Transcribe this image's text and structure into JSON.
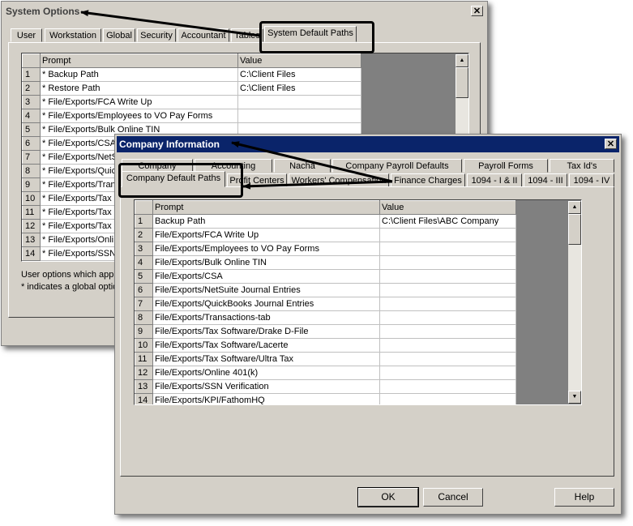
{
  "system_options": {
    "title": "System Options",
    "close_glyph": "✕",
    "tabs": [
      "User",
      "Workstation",
      "Global",
      "Security",
      "Accountant",
      "Tables",
      "System Default Paths"
    ],
    "headers": {
      "prompt": "Prompt",
      "value": "Value"
    },
    "rows": [
      {
        "n": "1",
        "prompt": "* Backup Path",
        "value": "C:\\Client Files"
      },
      {
        "n": "2",
        "prompt": "* Restore Path",
        "value": "C:\\Client Files"
      },
      {
        "n": "3",
        "prompt": "* File/Exports/FCA Write Up",
        "value": ""
      },
      {
        "n": "4",
        "prompt": "* File/Exports/Employees to VO Pay Forms",
        "value": ""
      },
      {
        "n": "5",
        "prompt": "* File/Exports/Bulk Online TIN",
        "value": ""
      },
      {
        "n": "6",
        "prompt": "* File/Exports/CSA",
        "value": ""
      },
      {
        "n": "7",
        "prompt": "* File/Exports/NetS",
        "value": ""
      },
      {
        "n": "8",
        "prompt": "* File/Exports/Quic",
        "value": ""
      },
      {
        "n": "9",
        "prompt": "* File/Exports/Tran",
        "value": ""
      },
      {
        "n": "10",
        "prompt": "* File/Exports/Tax",
        "value": ""
      },
      {
        "n": "11",
        "prompt": "* File/Exports/Tax",
        "value": ""
      },
      {
        "n": "12",
        "prompt": "* File/Exports/Tax",
        "value": ""
      },
      {
        "n": "13",
        "prompt": "* File/Exports/Onli",
        "value": ""
      },
      {
        "n": "14",
        "prompt": "* File/Exports/SSN",
        "value": ""
      }
    ],
    "note_line1": "User options which appl",
    "note_line2": "* indicates a global optio"
  },
  "company_info": {
    "title": "Company Information",
    "close_glyph": "✕",
    "tabs_back": [
      "Company",
      "Accounting",
      "Nacha",
      "Company Payroll Defaults",
      "Payroll Forms",
      "Tax Id's"
    ],
    "tabs_front": [
      "Company Default Paths",
      "Profit Centers",
      "Workers' Compensation",
      "Finance Charges",
      "1094 - I & II",
      "1094 - III",
      "1094 - IV"
    ],
    "headers": {
      "prompt": "Prompt",
      "value": "Value"
    },
    "rows": [
      {
        "n": "1",
        "prompt": "Backup Path",
        "value": "C:\\Client Files\\ABC Company"
      },
      {
        "n": "2",
        "prompt": "File/Exports/FCA Write Up",
        "value": ""
      },
      {
        "n": "3",
        "prompt": "File/Exports/Employees to VO Pay Forms",
        "value": ""
      },
      {
        "n": "4",
        "prompt": "File/Exports/Bulk Online TIN",
        "value": ""
      },
      {
        "n": "5",
        "prompt": "File/Exports/CSA",
        "value": ""
      },
      {
        "n": "6",
        "prompt": "File/Exports/NetSuite Journal Entries",
        "value": ""
      },
      {
        "n": "7",
        "prompt": "File/Exports/QuickBooks Journal Entries",
        "value": ""
      },
      {
        "n": "8",
        "prompt": "File/Exports/Transactions-tab",
        "value": ""
      },
      {
        "n": "9",
        "prompt": "File/Exports/Tax Software/Drake D-File",
        "value": ""
      },
      {
        "n": "10",
        "prompt": "File/Exports/Tax Software/Lacerte",
        "value": ""
      },
      {
        "n": "11",
        "prompt": "File/Exports/Tax Software/Ultra Tax",
        "value": ""
      },
      {
        "n": "12",
        "prompt": "File/Exports/Online 401(k)",
        "value": ""
      },
      {
        "n": "13",
        "prompt": "File/Exports/SSN Verification",
        "value": ""
      },
      {
        "n": "14",
        "prompt": "File/Exports/KPI/FathomHQ",
        "value": ""
      }
    ],
    "buttons": {
      "ok": "OK",
      "cancel": "Cancel",
      "help": "Help"
    }
  },
  "icons": {
    "scroll_up": "▲",
    "scroll_down": "▼"
  }
}
